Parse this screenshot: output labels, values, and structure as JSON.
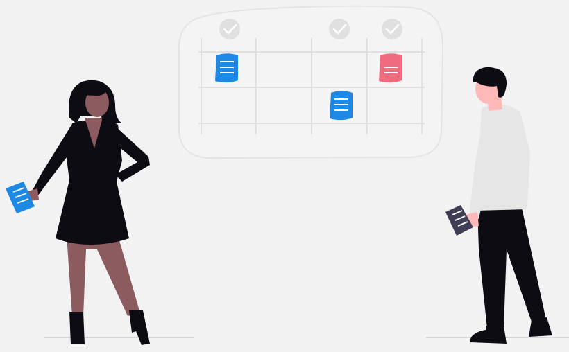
{
  "colors": {
    "background": "#f2f2f2",
    "board_stroke": "#e6e6e6",
    "grid_line": "#e0e0e0",
    "check_circle": "#e0e0e0",
    "check_mark": "#ffffff",
    "doc_blue": "#1e88e5",
    "doc_red": "#f06b7d",
    "doc_dark": "#3f3d56",
    "skin_dark": "#8b5b5f",
    "hair_dark": "#2f2e41",
    "dress": "#0d0c12",
    "shirt": "#e6e6e6",
    "pants": "#0d0c12",
    "skin_light": "#ffb8b8",
    "ground": "#d0d0d0"
  },
  "board": {
    "columns": 4,
    "rows": 3,
    "checked_columns": [
      1,
      3,
      4
    ],
    "documents": [
      {
        "column": 1,
        "row": 1,
        "color": "doc_blue",
        "icon": "document-icon"
      },
      {
        "column": 4,
        "row": 1,
        "color": "doc_red",
        "icon": "document-icon"
      },
      {
        "column": 3,
        "row": 2,
        "color": "doc_blue",
        "icon": "document-icon"
      }
    ]
  },
  "people": [
    {
      "name": "woman-figure",
      "holding": "blue-document",
      "outfit": "black-dress"
    },
    {
      "name": "man-figure",
      "holding": "dark-document",
      "outfit": "shirt-and-pants"
    }
  ]
}
